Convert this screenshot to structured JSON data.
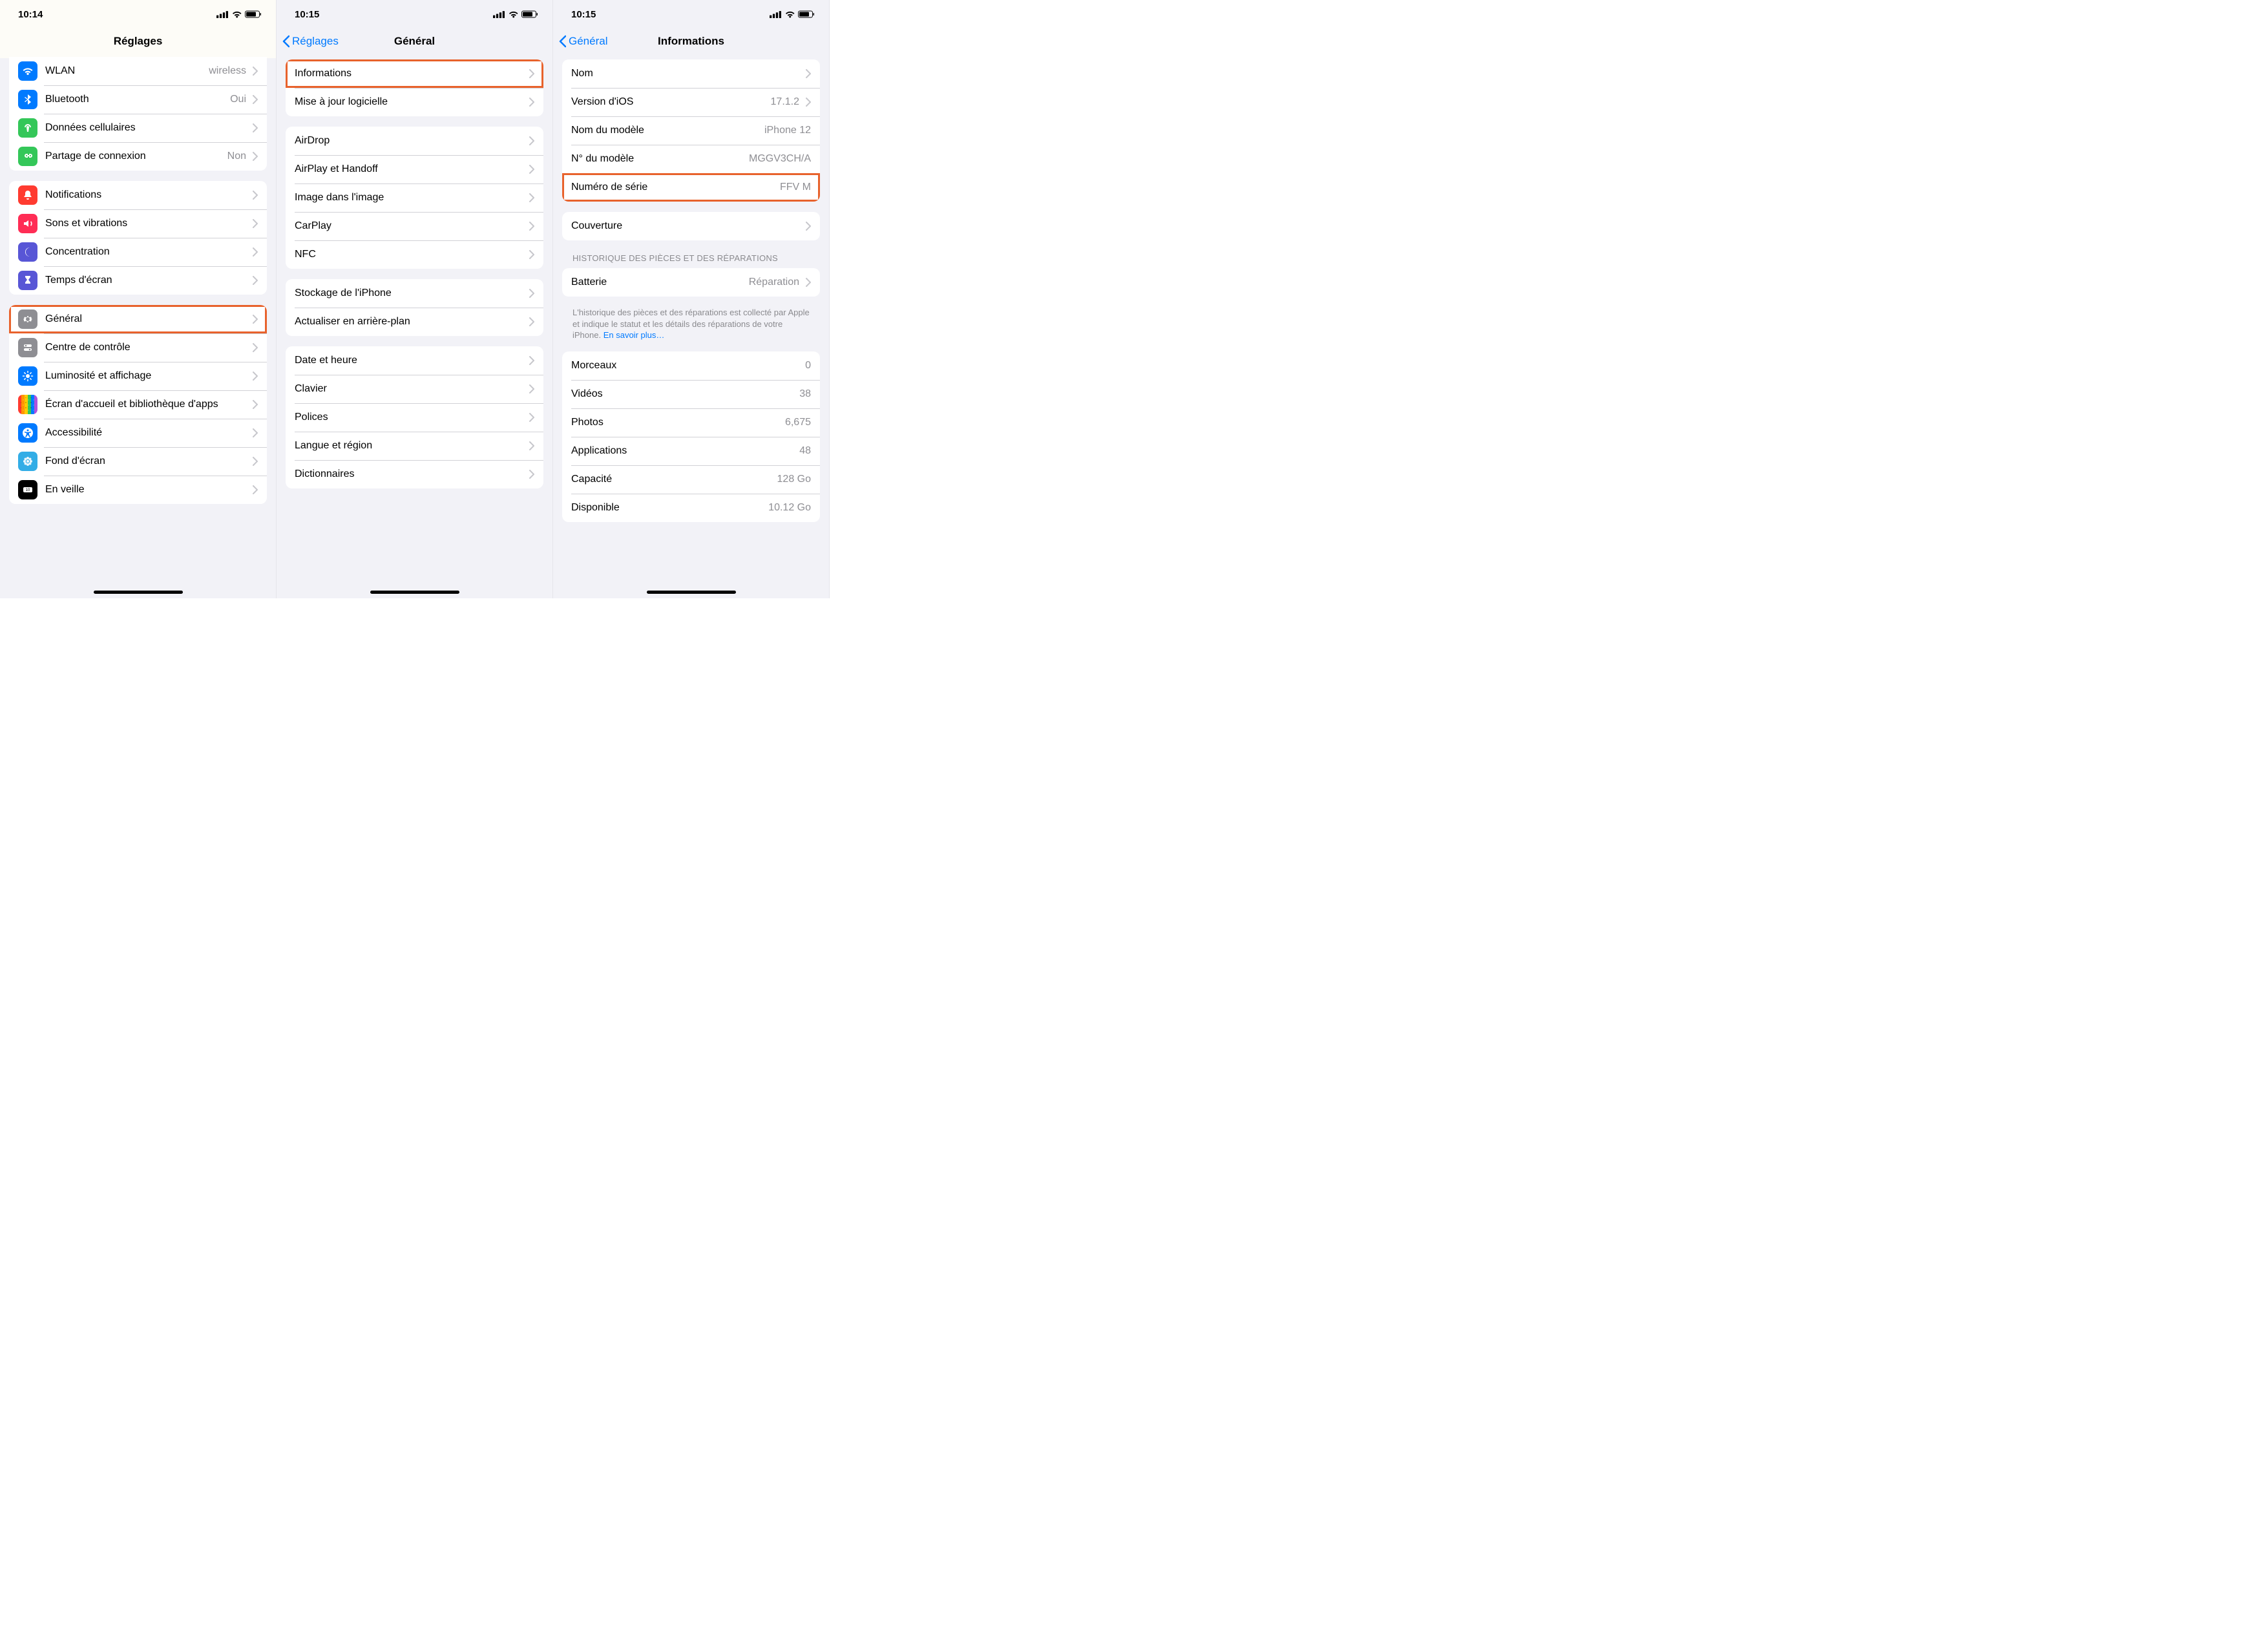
{
  "screen1": {
    "time": "10:14",
    "title": "Réglages",
    "group1": [
      {
        "icon": "wifi-icon",
        "color": "ic-blue",
        "label": "WLAN",
        "value": "wireless",
        "chevron": true
      },
      {
        "icon": "bluetooth-icon",
        "color": "ic-blue",
        "label": "Bluetooth",
        "value": "Oui",
        "chevron": true
      },
      {
        "icon": "antenna-icon",
        "color": "ic-green",
        "label": "Données cellulaires",
        "value": "",
        "chevron": true
      },
      {
        "icon": "link-icon",
        "color": "ic-green",
        "label": "Partage de connexion",
        "value": "Non",
        "chevron": true
      }
    ],
    "group2": [
      {
        "icon": "bell-icon",
        "color": "ic-red",
        "label": "Notifications",
        "chevron": true
      },
      {
        "icon": "speaker-icon",
        "color": "ic-redpink",
        "label": "Sons et vibrations",
        "chevron": true
      },
      {
        "icon": "moon-icon",
        "color": "ic-indigo",
        "label": "Concentration",
        "chevron": true
      },
      {
        "icon": "hourglass-icon",
        "color": "ic-indigo",
        "label": "Temps d'écran",
        "chevron": true
      }
    ],
    "group3": [
      {
        "icon": "gear-icon",
        "color": "ic-gray",
        "label": "Général",
        "chevron": true,
        "highlight": true
      },
      {
        "icon": "switches-icon",
        "color": "ic-gray",
        "label": "Centre de contrôle",
        "chevron": true
      },
      {
        "icon": "sun-icon",
        "color": "ic-blue",
        "label": "Luminosité et affichage",
        "chevron": true
      },
      {
        "icon": "grid-icon",
        "color": "ic-rainbow",
        "label": "Écran d'accueil et bibliothèque d'apps",
        "chevron": true
      },
      {
        "icon": "accessibility-icon",
        "color": "ic-blue",
        "label": "Accessibilité",
        "chevron": true
      },
      {
        "icon": "flower-icon",
        "color": "ic-cyan",
        "label": "Fond d'écran",
        "chevron": true
      },
      {
        "icon": "standby-icon",
        "color": "ic-black",
        "label": "En veille",
        "chevron": true
      }
    ]
  },
  "screen2": {
    "time": "10:15",
    "back": "Réglages",
    "title": "Général",
    "group1": [
      {
        "label": "Informations",
        "chevron": true,
        "highlight": true
      },
      {
        "label": "Mise à jour logicielle",
        "chevron": true
      }
    ],
    "group2": [
      {
        "label": "AirDrop",
        "chevron": true
      },
      {
        "label": "AirPlay et Handoff",
        "chevron": true
      },
      {
        "label": "Image dans l'image",
        "chevron": true
      },
      {
        "label": "CarPlay",
        "chevron": true
      },
      {
        "label": "NFC",
        "chevron": true
      }
    ],
    "group3": [
      {
        "label": "Stockage de l'iPhone",
        "chevron": true
      },
      {
        "label": "Actualiser en arrière-plan",
        "chevron": true
      }
    ],
    "group4": [
      {
        "label": "Date et heure",
        "chevron": true
      },
      {
        "label": "Clavier",
        "chevron": true
      },
      {
        "label": "Polices",
        "chevron": true
      },
      {
        "label": "Langue et région",
        "chevron": true
      },
      {
        "label": "Dictionnaires",
        "chevron": true
      }
    ]
  },
  "screen3": {
    "time": "10:15",
    "back": "Général",
    "title": "Informations",
    "group1": [
      {
        "label": "Nom",
        "value": "",
        "chevron": true
      },
      {
        "label": "Version d'iOS",
        "value": "17.1.2",
        "chevron": true
      },
      {
        "label": "Nom du modèle",
        "value": "iPhone 12"
      },
      {
        "label": "N° du modèle",
        "value": "MGGV3CH/A"
      },
      {
        "label": "Numéro de série",
        "value": "FFV                M",
        "highlight": true
      }
    ],
    "group2": [
      {
        "label": "Couverture",
        "chevron": true
      }
    ],
    "section_header": "HISTORIQUE DES PIÈCES ET DES RÉPARATIONS",
    "group3": [
      {
        "label": "Batterie",
        "value": "Réparation",
        "chevron": true
      }
    ],
    "footer_text": "L'historique des pièces et des réparations est collecté par Apple et indique le statut et les détails des réparations de votre iPhone. ",
    "footer_link": "En savoir plus…",
    "group4": [
      {
        "label": "Morceaux",
        "value": "0"
      },
      {
        "label": "Vidéos",
        "value": "38"
      },
      {
        "label": "Photos",
        "value": "6,675"
      },
      {
        "label": "Applications",
        "value": "48"
      },
      {
        "label": "Capacité",
        "value": "128 Go"
      },
      {
        "label": "Disponible",
        "value": "10.12 Go"
      }
    ]
  }
}
